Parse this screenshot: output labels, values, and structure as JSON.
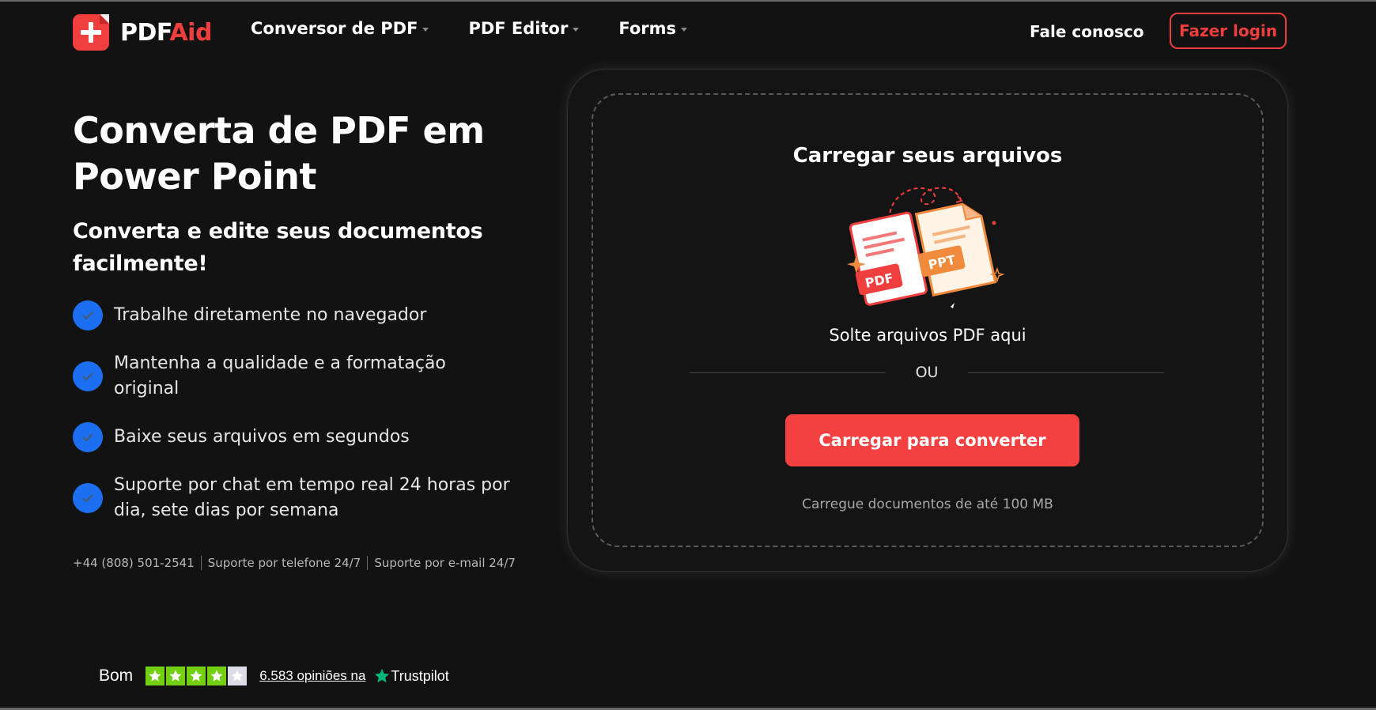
{
  "header": {
    "logo": {
      "part1": "PDF",
      "part2": "Aid"
    },
    "nav": [
      {
        "label": "Conversor de PDF"
      },
      {
        "label": "PDF Editor"
      },
      {
        "label": "Forms"
      }
    ],
    "contact_label": "Fale conosco",
    "login_label": "Fazer login"
  },
  "hero": {
    "title": "Converta de PDF em Power Point",
    "subtitle": "Converta e edite seus documentos facilmente!",
    "features": [
      "Trabalhe diretamente no navegador",
      "Mantenha a qualidade e a formatação original",
      "Baixe seus arquivos em segundos",
      "Suporte por chat em tempo real 24 horas por dia, sete dias por semana"
    ],
    "support": {
      "phone": "+44 (808) 501-2541",
      "phone_support": "Suporte por telefone 24/7",
      "email_support": "Suporte por e-mail 24/7"
    }
  },
  "upload": {
    "title": "Carregar seus arquivos",
    "illustration": {
      "pdf_label": "PDF",
      "ppt_label": "PPT"
    },
    "drop_text": "Solte arquivos PDF aqui",
    "or_text": "OU",
    "button_label": "Carregar para converter",
    "limit_text": "Carregue documentos de até 100 MB"
  },
  "trustpilot": {
    "rating_label": "Bom",
    "stars_filled": 4,
    "stars_total": 5,
    "reviews_label": "6.583 opiniões na",
    "brand": "Trustpilot"
  },
  "colors": {
    "background": "#121212",
    "accent_red": "#ef3e3e",
    "check_blue": "#1d6ff2",
    "trust_green": "#73cf11"
  }
}
